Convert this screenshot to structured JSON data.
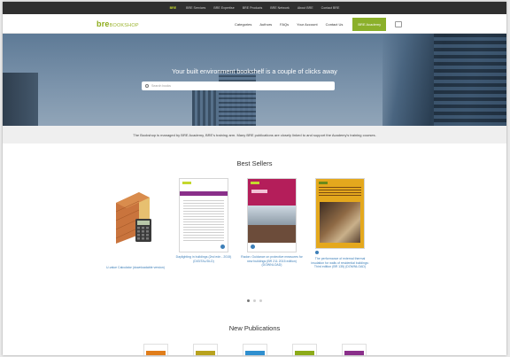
{
  "topbar": {
    "brand": "BRE",
    "links": [
      "BRE Services",
      "BRE Expertise",
      "BRE Products",
      "BRE Network",
      "About BRE",
      "Contact BRE"
    ]
  },
  "nav": {
    "logo_main": "bre",
    "logo_sub": "BOOKSHOP",
    "links": [
      "Categories",
      "Authors",
      "FAQs",
      "Your Account",
      "Contact Us"
    ],
    "cta": "BRE Academy"
  },
  "hero": {
    "title": "Your built environment bookshelf is a couple of clicks away",
    "search_placeholder": "Search books"
  },
  "info": {
    "text": "The Bookshop is managed by BRE Academy, BRE's training arm. Many BRE publications are closely linked to and support the Academy's training courses."
  },
  "best_sellers": {
    "title": "Best Sellers",
    "items": [
      {
        "caption": "U-value Calculator (downloadable version)"
      },
      {
        "caption": "Daylighting in buildings (2nd edn - 2015) (DIGITAL/DLD)"
      },
      {
        "caption": "Radon: Guidance on protective measures for new buildings (BR 211 2015 edition) (DOWNLOAD)"
      },
      {
        "caption": "The performance of external thermal insulation for walls of residential buildings: Third edition (BR 135) (DOWNLOAD)"
      }
    ]
  },
  "new_publications": {
    "title": "New Publications"
  },
  "colors": {
    "accent_green": "#8bb02a",
    "link_blue": "#3d7fb8"
  }
}
